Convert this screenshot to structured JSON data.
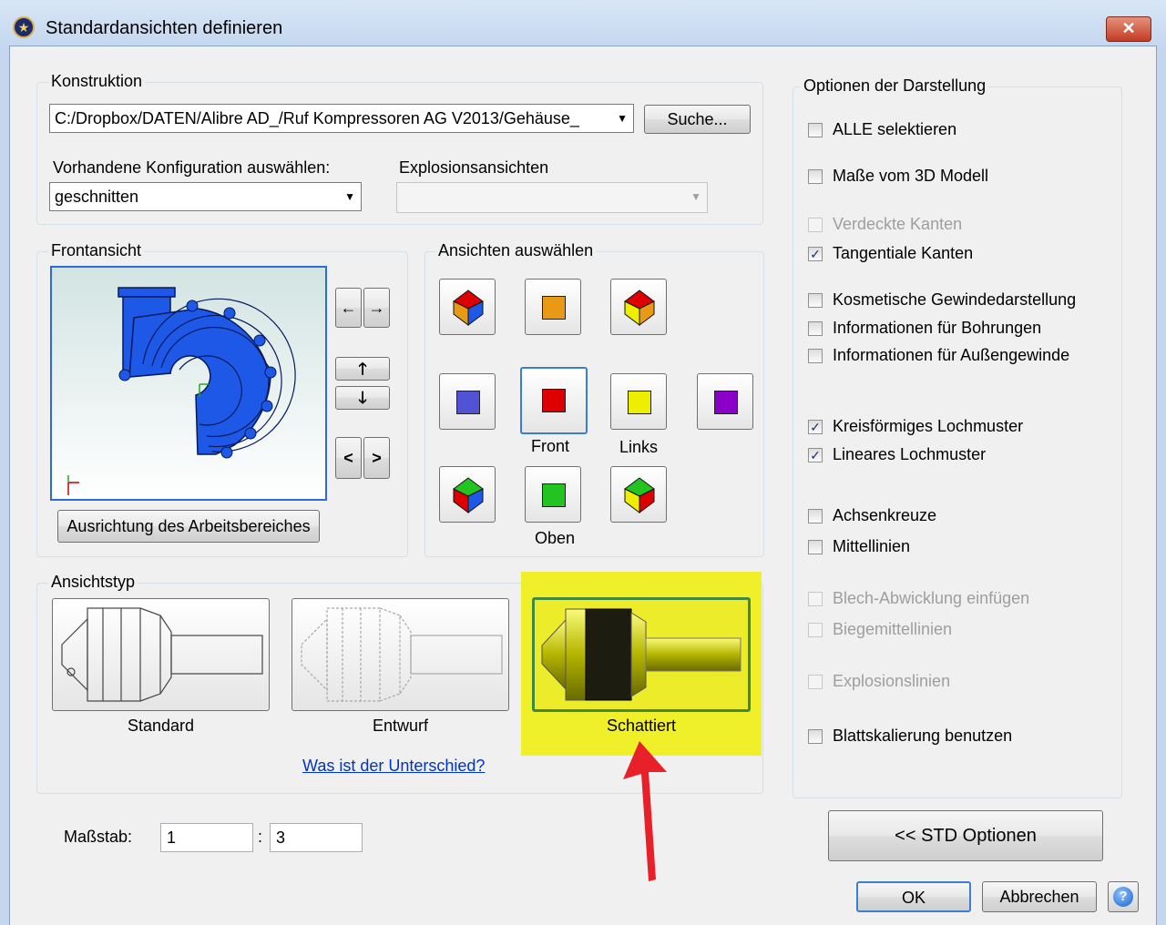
{
  "window": {
    "title": "Standardansichten definieren",
    "close_glyph": "✕"
  },
  "construction": {
    "group_label": "Konstruktion",
    "path_value": "C:/Dropbox/DATEN/Alibre AD_/Ruf Kompressoren AG V2013/Gehäuse_",
    "search_button": "Suche...",
    "config_label": "Vorhandene Konfiguration auswählen:",
    "config_value": "geschnitten",
    "explosion_label": "Explosionsansichten",
    "explosion_value": ""
  },
  "front_view": {
    "group_label": "Frontansicht",
    "align_button": "Ausrichtung des Arbeitsbereiches"
  },
  "select_views": {
    "group_label": "Ansichten auswählen",
    "front_label": "Front",
    "left_label": "Links",
    "top_label": "Oben"
  },
  "view_type": {
    "group_label": "Ansichtstyp",
    "standard_label": "Standard",
    "draft_label": "Entwurf",
    "shaded_label": "Schattiert",
    "difference_link": "Was ist der Unterschied?",
    "selected": "Schattiert"
  },
  "scale": {
    "label": "Maßstab:",
    "left_value": "1",
    "separator": ":",
    "right_value": "3"
  },
  "options": {
    "group_label": "Optionen der Darstellung",
    "items": [
      {
        "label": "ALLE selektieren",
        "checked": false,
        "enabled": true
      },
      {
        "label": "Maße vom 3D Modell",
        "checked": false,
        "enabled": true
      },
      {
        "label": "Verdeckte Kanten",
        "checked": false,
        "enabled": false
      },
      {
        "label": "Tangentiale Kanten",
        "checked": true,
        "enabled": true
      },
      {
        "label": "Kosmetische Gewindedarstellung",
        "checked": false,
        "enabled": true
      },
      {
        "label": "Informationen für Bohrungen",
        "checked": false,
        "enabled": true
      },
      {
        "label": "Informationen für Außengewinde",
        "checked": false,
        "enabled": true
      },
      {
        "label": "Kreisförmiges Lochmuster",
        "checked": true,
        "enabled": true
      },
      {
        "label": "Lineares Lochmuster",
        "checked": true,
        "enabled": true
      },
      {
        "label": "Achsenkreuze",
        "checked": false,
        "enabled": true
      },
      {
        "label": "Mittellinien",
        "checked": false,
        "enabled": true
      },
      {
        "label": "Blech-Abwicklung einfügen",
        "checked": false,
        "enabled": false
      },
      {
        "label": "Biegemittellinien",
        "checked": false,
        "enabled": false
      },
      {
        "label": "Explosionslinien",
        "checked": false,
        "enabled": false
      },
      {
        "label": "Blattskalierung benutzen",
        "checked": false,
        "enabled": true
      }
    ]
  },
  "buttons": {
    "std_options": "<< STD Optionen",
    "ok": "OK",
    "cancel": "Abbrechen",
    "help_glyph": "?"
  },
  "icons": {
    "arrow_left": "←",
    "arrow_right": "→",
    "arrow_up": "🡑",
    "arrow_down": "🡓",
    "rotate_left": "<",
    "rotate_right": ">",
    "check": "✓",
    "dropdown": "▼"
  },
  "colors": {
    "title_gradient_top": "#d8e6f7",
    "highlight": "#f0f02a",
    "view_back": "#5252d6",
    "view_front": "#dd0000",
    "view_left": "#eeee00",
    "view_right": "#8a00c8",
    "view_top": "#22c422",
    "view_bottom": "#e89a14",
    "model_blue": "#1d59e6",
    "annotation_arrow": "#e8202a"
  }
}
